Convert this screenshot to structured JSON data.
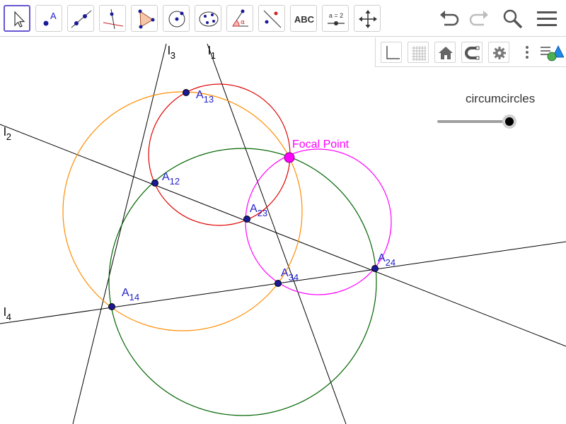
{
  "toolbar": {
    "tools": [
      {
        "name": "move-tool",
        "selected": true
      },
      {
        "name": "point-tool"
      },
      {
        "name": "line-tool"
      },
      {
        "name": "perpendicular-line-tool"
      },
      {
        "name": "polygon-tool"
      },
      {
        "name": "circle-center-point-tool"
      },
      {
        "name": "conic-through-5-points-tool"
      },
      {
        "name": "angle-tool"
      },
      {
        "name": "reflect-about-line-tool"
      },
      {
        "name": "text-tool",
        "label": "ABC"
      },
      {
        "name": "slider-tool",
        "label": "a = 2"
      },
      {
        "name": "move-graphics-view-tool"
      }
    ],
    "right_buttons": [
      "undo-icon",
      "redo-icon",
      "search-icon",
      "menu-icon"
    ]
  },
  "style_bar": [
    "axes-icon",
    "grid-icon",
    "home-icon",
    "magnet-icon",
    "gear-icon",
    "more-vertical-icon",
    "algebra-view-icon"
  ],
  "slider": {
    "label": "circumcircles",
    "value": 1.0
  },
  "lines": [
    {
      "id": "l1",
      "label": "l",
      "sub": "1"
    },
    {
      "id": "l2",
      "label": "l",
      "sub": "2"
    },
    {
      "id": "l3",
      "label": "l",
      "sub": "3"
    },
    {
      "id": "l4",
      "label": "l",
      "sub": "4"
    }
  ],
  "points": [
    {
      "id": "A13",
      "label": "A",
      "sub": "13"
    },
    {
      "id": "A12",
      "label": "A",
      "sub": "12"
    },
    {
      "id": "A23",
      "label": "A",
      "sub": "23"
    },
    {
      "id": "A14",
      "label": "A",
      "sub": "14"
    },
    {
      "id": "A34",
      "label": "A",
      "sub": "34"
    },
    {
      "id": "A24",
      "label": "A",
      "sub": "24"
    }
  ],
  "focal_point": {
    "label": "Focal Point"
  },
  "circles": [
    {
      "id": "circ-red",
      "color": "#e00000"
    },
    {
      "id": "circ-orange",
      "color": "#ff8c00"
    },
    {
      "id": "circ-green",
      "color": "#006400"
    },
    {
      "id": "circ-magenta",
      "color": "#ff00ff"
    }
  ],
  "colors": {
    "accent": "#6557d2",
    "point_fill": "#1a1a99",
    "point_label": "#2222cc",
    "focal": "#ff00ff",
    "line": "#000000"
  }
}
